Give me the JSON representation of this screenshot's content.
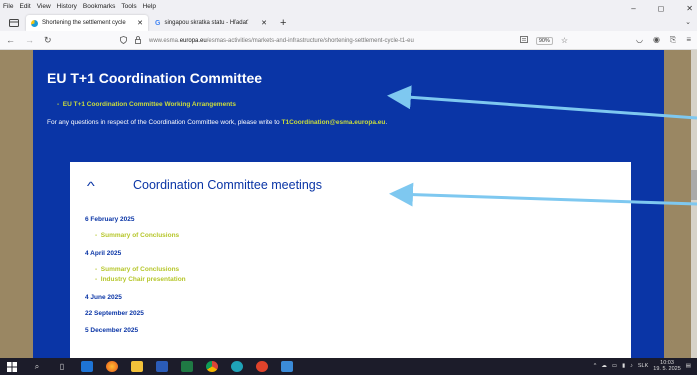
{
  "menu": [
    "File",
    "Edit",
    "View",
    "History",
    "Bookmarks",
    "Tools",
    "Help"
  ],
  "window_controls": [
    "–",
    "◻",
    "✕"
  ],
  "tabs": [
    {
      "label": "Shortening the settlement cycle",
      "close": "✕",
      "active": true
    },
    {
      "label": "singapou skratka statu - Hľadať",
      "close": "✕",
      "active": false
    }
  ],
  "new_tab": "+",
  "nav": {
    "back": "←",
    "forward": "→",
    "reload": "↻"
  },
  "url": {
    "prefix": "www.esma.",
    "domain": "europa.eu",
    "path": "/esmas-activities/markets-and-infrastructure/shortening-settlement-cycle-t1-eu"
  },
  "zoom": "90%",
  "panel": {
    "title": "EU T+1 Coordination Committee",
    "link_text": "EU T+1 Coordination Committee Working Arrangements",
    "text_prefix": "For any questions in respect of the Coordination Committee work, please write to",
    "email": "T1Coordination@esma.europa.eu",
    "text_suffix": "."
  },
  "card": {
    "title": "Coordination Committee meetings",
    "meetings": [
      {
        "date": "6 February 2025",
        "docs": [
          "Summary of Conclusions"
        ]
      },
      {
        "date": "4 April 2025",
        "docs": [
          "Summary of Conclusions",
          "Industry Chair presentation"
        ]
      },
      {
        "date": "4 June 2025",
        "docs": []
      },
      {
        "date": "22 September 2025",
        "docs": []
      },
      {
        "date": "5 December 2025",
        "docs": []
      }
    ]
  },
  "taskbar": {
    "lang": "SLK",
    "time": "10:03",
    "date": "19. 5. 2025"
  },
  "colors": {
    "esma_blue": "#0a35a6",
    "lime": "#c9dc3c",
    "arrow": "#7ec8f0"
  }
}
